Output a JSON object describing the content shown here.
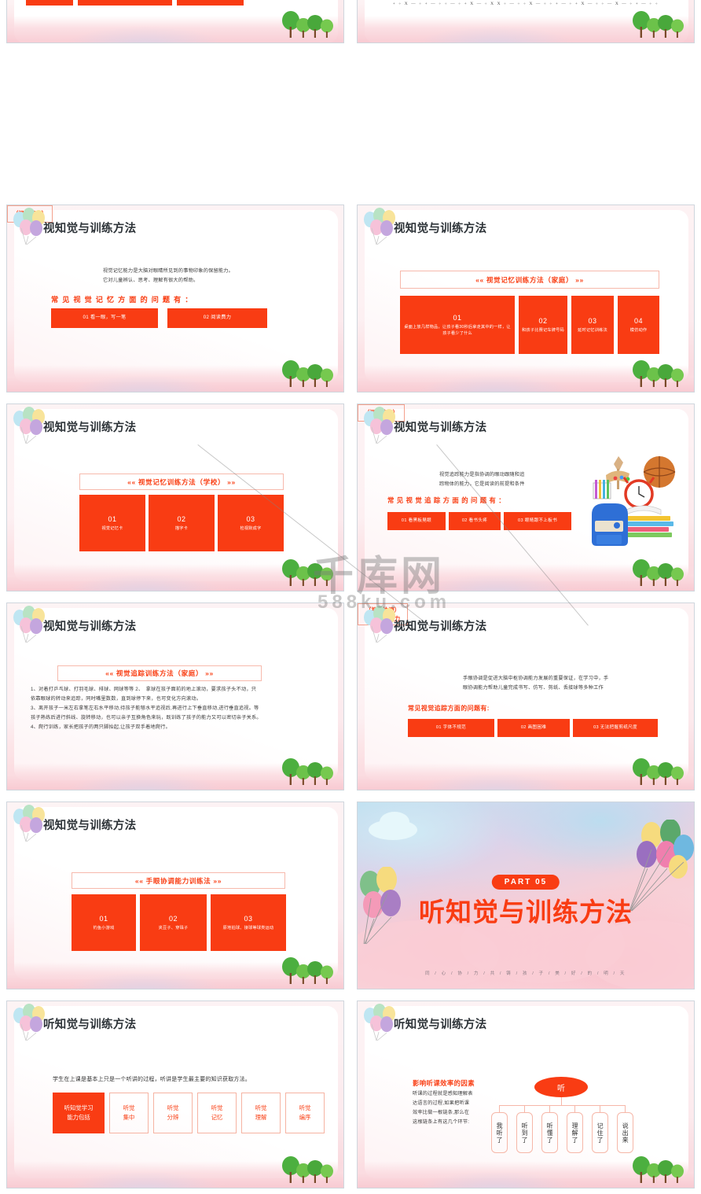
{
  "watermark": {
    "main": "千库网",
    "sub": "588ku.com"
  },
  "slides": [
    {
      "id": "cut-top-left",
      "type": "cut",
      "boxes": [
        "",
        "",
        ""
      ]
    },
    {
      "id": "cut-top-right",
      "type": "cut-math",
      "math": "+ ÷ X — ÷ + — ÷ ÷ — ÷ + X — ÷ X X ÷ — ÷ ÷ X — ÷ ÷ + — ÷ + X — ÷ ÷ — X — ÷ + — ÷ ÷"
    },
    {
      "id": "visual-memory-intro",
      "type": "definition",
      "title": "视知觉与训练方法",
      "tag": "（视觉记忆）",
      "paragraph_lines": [
        "视觉记忆能力是大脑对眼睛所见到的事物印象的保留能力。",
        "它对儿童辨认、思考、理解有很大的帮助。"
      ],
      "question_head": "常见视觉记忆方面的问题有：",
      "items": [
        "01 看一眼，写一笔",
        "02 阅读费力"
      ]
    },
    {
      "id": "visual-memory-home",
      "type": "numbered",
      "title": "视知觉与训练方法",
      "band": "«« 视觉记忆训练方法（家庭） »»",
      "items": [
        {
          "num": "01",
          "desc": "桌面上放几样物品，让孩子看30秒后拿走其中的一样，让孩子看少了什么"
        },
        {
          "num": "02",
          "desc": "和孩子比赛记车牌号码"
        },
        {
          "num": "03",
          "desc": "延时记忆训练法"
        },
        {
          "num": "04",
          "desc": "模仿动作"
        }
      ]
    },
    {
      "id": "visual-memory-school",
      "type": "numbered",
      "title": "视知觉与训练方法",
      "band": "«« 视觉记忆训练方法（学校） »»",
      "items": [
        {
          "num": "01",
          "desc": "视觉记忆卡"
        },
        {
          "num": "02",
          "desc": "描字卡"
        },
        {
          "num": "03",
          "desc": "检视默成字"
        }
      ]
    },
    {
      "id": "visual-tracking-intro",
      "type": "definition-illustrated",
      "title": "视知觉与训练方法",
      "tag": "（视觉追踪）",
      "paragraph_lines": [
        "视觉追踪能力是指协调的眼动跟随和追",
        "踪物体的能力，它是阅读的前提和条件"
      ],
      "question_head": "常见视觉追踪方面的问题有：",
      "items": [
        "01 看黑板晃眼",
        "02 看书头疼",
        "03 眼睛跟不上板书"
      ]
    },
    {
      "id": "visual-tracking-home",
      "type": "textlist",
      "title": "视知觉与训练方法",
      "band": "«« 视觉追踪训练方法（家庭） »»",
      "lines": [
        "1、对着打乒乓球、打羽毛球、排球、网球等等  2、　拿球在孩子面前的地上滚动，要求孩子头不动，只",
        "依靠眼球的转动来追踪，同时嘴里数数，直到球停下来，也可变化方向滚动。",
        "3、离开孩子一米左右拿笔左右水平移动,待孩子能够水平追视后,再进行上下垂直移动,进行垂直追视。等",
        "孩子熟练后进行斜线、旋转移动，也可以亲子互换角色来玩，既训练了孩子的能力又可以密切亲子关系。",
        "4、爬行训练，家长把孩子的两只脚抬起,让孩子双手着地爬行。"
      ]
    },
    {
      "id": "visuomotor-coordination",
      "type": "definition",
      "title": "视知觉与训练方法",
      "tag_lines": [
        "（视动协调）",
        "手眼协调能力"
      ],
      "paragraph_lines": [
        "手眼协调是促进大脑中枢协调能力发展的重要保证，在学习中，手",
        "眼协调能力帮助儿童完成书写、仿写、剪纸、丢接球等多种工作"
      ],
      "question_head": "常见视觉追踪方面的问题有:",
      "items": [
        "01 字体不规范",
        "02 画图困难",
        "03 无法把握剪纸尺度"
      ]
    },
    {
      "id": "hand-eye-training",
      "type": "numbered",
      "title": "视知觉与训练方法",
      "band": "«« 手眼协调能力训练法 »»",
      "items": [
        {
          "num": "01",
          "desc": "钓鱼小游戏"
        },
        {
          "num": "02",
          "desc": "夹豆子、穿珠子"
        },
        {
          "num": "03",
          "desc": "原地拍球、接球等球类运动"
        }
      ]
    },
    {
      "id": "part-05-divider",
      "type": "divider",
      "pill": "PART 05",
      "title": "听知觉与训练方法",
      "subtitle": "同 / 心 / 协 / 力 / 共 / 铸 / 孩 / 子 / 美 / 好 / 的 / 明 / 天"
    },
    {
      "id": "auditory-abilities",
      "type": "listenboxes",
      "title": "听知觉与训练方法",
      "lead": "学生在上课是基本上只是一个听讲的过程，听讲是学生最主要的知识获取方法。",
      "boxes": [
        {
          "lines": [
            "听知觉学习",
            "能力包括"
          ],
          "filled": true
        },
        {
          "lines": [
            "听觉",
            "集中"
          ],
          "filled": false
        },
        {
          "lines": [
            "听觉",
            "分辨"
          ],
          "filled": false
        },
        {
          "lines": [
            "听觉",
            "记忆"
          ],
          "filled": false
        },
        {
          "lines": [
            "听觉",
            "理解"
          ],
          "filled": false
        },
        {
          "lines": [
            "听觉",
            "编序"
          ],
          "filled": false
        }
      ]
    },
    {
      "id": "listening-efficiency",
      "type": "treediagram",
      "title": "听知觉与训练方法",
      "section_head": "影响听课效率的因素",
      "body_lines": [
        "听课的过程就是感知理解表",
        "达语言的过程,如果把听课",
        "效率比做一根链条,那么在",
        "这根链条上有这几个环节:"
      ],
      "root": "听",
      "nodes": [
        "我听了",
        "听到了",
        "听懂了",
        "理解了",
        "记住了",
        "说出来"
      ]
    }
  ],
  "colors": {
    "orange": "#f93c13",
    "orange_text": "#f94016",
    "outline_pink": "#f6b3a2",
    "title_dark": "#2d3338"
  }
}
